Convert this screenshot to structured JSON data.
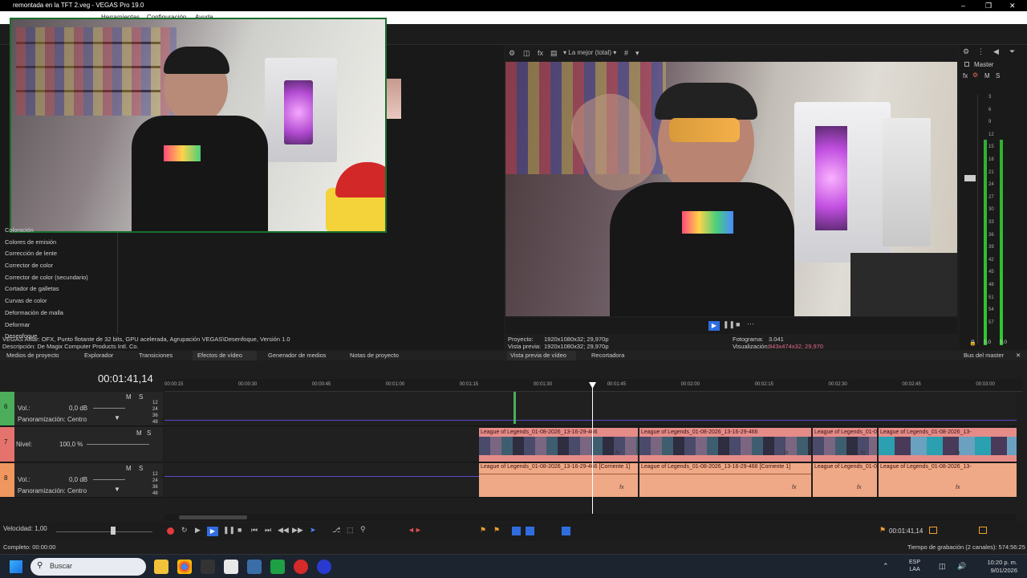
{
  "window": {
    "title": "remontada en la TFT 2.veg - VEGAS Pro 19.0"
  },
  "menu": {
    "items": [
      "Herramientas",
      "Configuración",
      "Ayuda"
    ]
  },
  "preview_toolbar": {
    "quality": "La mejor (total)"
  },
  "master": {
    "title": "Master",
    "m": "M",
    "s": "S",
    "scale": [
      "3",
      "6",
      "9",
      "12",
      "15",
      "18",
      "21",
      "24",
      "27",
      "30",
      "33",
      "36",
      "39",
      "42",
      "45",
      "48",
      "51",
      "54",
      "57"
    ],
    "readout_left": "0.0",
    "readout_right": "0.0",
    "db_left": "-Inf.",
    "db_right": "-Inf."
  },
  "fx_list": {
    "items": [
      "Coloración",
      "Colores de emisión",
      "Corrección de lente",
      "Corrector de color",
      "Corrector de color (secundario)",
      "Cortador de galletas",
      "Curvas de color",
      "Deformación de malla",
      "Deformar",
      "Desenfoque"
    ]
  },
  "plugin_desc": {
    "line1": "VEGAS Afilar: OFX, Punto flotante de 32 bits, GPU acelerada, Agrupación VEGAS\\Desenfoque, Versión 1.0",
    "line2": "Descripción: De Magix Computer Products Intl. Co."
  },
  "preview_info": {
    "proyecto_label": "Proyecto:",
    "proyecto_val": "1920x1080x32; 29,970p",
    "vista_label": "Vista previa:",
    "vista_val": "1920x1080x32; 29,970p",
    "fotograma_label": "Fotograma:",
    "fotograma_val": "3.041",
    "visual_label": "Visualización:",
    "visual_val": "843x474x32; 29,970"
  },
  "tabs": {
    "left": [
      "Medios de proyecto",
      "Explorador",
      "Transiciones",
      "Efectos de vídeo",
      "Generador de medios",
      "Notas de proyecto"
    ],
    "middle": [
      "Vista previa de vídeo",
      "Recortadora"
    ],
    "right": "Bus del master"
  },
  "timeline": {
    "timecode": "00:01:41,14",
    "ruler": [
      "00:00:15",
      "00:00:30",
      "00:00:45",
      "00:01:00",
      "00:01:15",
      "00:01:30",
      "00:01:45",
      "00:02:00",
      "00:02:15",
      "00:02:30",
      "00:02:45",
      "00:03:00"
    ],
    "db_scale": [
      "12",
      "24",
      "36",
      "48"
    ],
    "tracks": [
      {
        "num": "6",
        "vol_label": "Vol.:",
        "vol_val": "0,0 dB",
        "pan_label": "Panoramización:",
        "pan_val": "Centro",
        "m": "M",
        "s": "S"
      },
      {
        "num": "7",
        "level_label": "Nivel:",
        "level_val": "100,0 %",
        "m": "M",
        "s": "S"
      },
      {
        "num": "8",
        "vol_label": "Vol.:",
        "vol_val": "0,0 dB",
        "pan_label": "Panoramización:",
        "pan_val": "Centro",
        "m": "M",
        "s": "S"
      }
    ],
    "video_clips": [
      "League of Legends_01-08-2026_13-16-29-466",
      "League of Legends_01-08-2026_13-16-29-466",
      "League of Legends_01-0",
      "League of Legends_01-08-2026_13-"
    ],
    "audio_clips": [
      "League of Legends_01-08-2026_13-16-29-466 [Corriente 1]",
      "League of Legends_01-08-2026_13-16-29-466 [Corriente 1]",
      "League of Legends_01-0",
      "League of Legends_01-08-2026_13-"
    ],
    "fx_label": "fx"
  },
  "bottom": {
    "speed_label": "Velocidad: 1,00",
    "position": "00:01:41,14"
  },
  "status": {
    "left": "Completo: 00:00:00",
    "right": "Tiempo de grabación (2 canales): 574:56:25"
  },
  "taskbar": {
    "search_placeholder": "Buscar",
    "lang1": "ESP",
    "lang2": "LAA",
    "time": "10:20 p. m.",
    "date": "9/01/2026"
  }
}
